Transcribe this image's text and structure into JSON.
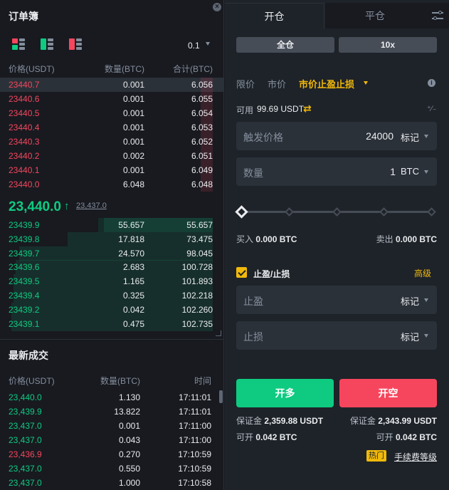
{
  "colors": {
    "buy": "#0ecb81",
    "sell": "#f6465d",
    "accent": "#f0b90b",
    "panel": "#1e2329",
    "bg": "#181a20"
  },
  "orderbook": {
    "title": "订单簿",
    "precision": "0.1",
    "columns": {
      "price": "价格(USDT)",
      "qty": "数量(BTC)",
      "total": "合计(BTC)"
    },
    "asks": [
      {
        "price": "23440.7",
        "qty": "0.001",
        "total": "6.056",
        "depth": 0.06
      },
      {
        "price": "23440.6",
        "qty": "0.001",
        "total": "6.055",
        "depth": 0.06
      },
      {
        "price": "23440.5",
        "qty": "0.001",
        "total": "6.054",
        "depth": 0.06
      },
      {
        "price": "23440.4",
        "qty": "0.001",
        "total": "6.053",
        "depth": 0.06
      },
      {
        "price": "23440.3",
        "qty": "0.001",
        "total": "6.052",
        "depth": 0.06
      },
      {
        "price": "23440.2",
        "qty": "0.002",
        "total": "6.051",
        "depth": 0.06
      },
      {
        "price": "23440.1",
        "qty": "0.001",
        "total": "6.049",
        "depth": 0.06
      },
      {
        "price": "23440.0",
        "qty": "6.048",
        "total": "6.048",
        "depth": 0.06
      }
    ],
    "last_price": "23,440.0",
    "last_arrow": "↑",
    "mark_price": "23,437.0",
    "bids": [
      {
        "price": "23439.9",
        "qty": "55.657",
        "total": "55.657",
        "depth": 0.54,
        "depth2": 0.57
      },
      {
        "price": "23439.8",
        "qty": "17.818",
        "total": "73.475",
        "depth": 0.72,
        "depth2": 0.0
      },
      {
        "price": "23439.7",
        "qty": "24.570",
        "total": "98.045",
        "depth": 0.96,
        "depth2": 0.0
      },
      {
        "price": "23439.6",
        "qty": "2.683",
        "total": "100.728",
        "depth": 0.98,
        "depth2": 0.0
      },
      {
        "price": "23439.5",
        "qty": "1.165",
        "total": "101.893",
        "depth": 0.99,
        "depth2": 0.0
      },
      {
        "price": "23439.4",
        "qty": "0.325",
        "total": "102.218",
        "depth": 0.99,
        "depth2": 0.0
      },
      {
        "price": "23439.2",
        "qty": "0.042",
        "total": "102.260",
        "depth": 1.0,
        "depth2": 0.0
      },
      {
        "price": "23439.1",
        "qty": "0.475",
        "total": "102.735",
        "depth": 1.0,
        "depth2": 0.0
      }
    ]
  },
  "trades": {
    "title": "最新成交",
    "columns": {
      "price": "价格(USDT)",
      "qty": "数量(BTC)",
      "time": "时间"
    },
    "rows": [
      {
        "price": "23,440.0",
        "qty": "1.130",
        "time": "17:11:01",
        "side": "buy"
      },
      {
        "price": "23,439.9",
        "qty": "13.822",
        "time": "17:11:01",
        "side": "buy"
      },
      {
        "price": "23,437.0",
        "qty": "0.001",
        "time": "17:11:00",
        "side": "buy"
      },
      {
        "price": "23,437.0",
        "qty": "0.043",
        "time": "17:11:00",
        "side": "buy"
      },
      {
        "price": "23,436.9",
        "qty": "0.270",
        "time": "17:10:59",
        "side": "sell"
      },
      {
        "price": "23,437.0",
        "qty": "0.550",
        "time": "17:10:59",
        "side": "buy"
      },
      {
        "price": "23,437.0",
        "qty": "1.000",
        "time": "17:10:58",
        "side": "buy"
      }
    ]
  },
  "order_form": {
    "tabs": {
      "open": "开仓",
      "close": "平仓"
    },
    "margin_mode": "全仓",
    "leverage": "10x",
    "order_types": {
      "limit": "限价",
      "market": "市价",
      "stop_market": "市价止盈止损"
    },
    "available_label": "可用",
    "available_value": "99.69 USDT",
    "trigger": {
      "label": "触发价格",
      "value": "24000",
      "unit": "标记"
    },
    "amount": {
      "label": "数量",
      "value": "1",
      "unit": "BTC"
    },
    "slider_level": 0,
    "buy_label": "买入",
    "buy_value": "0.000 BTC",
    "sell_label": "卖出",
    "sell_value": "0.000 BTC",
    "tpsl_label": "止盈/止损",
    "advanced": "高级",
    "take_profit": {
      "label": "止盈",
      "unit": "标记"
    },
    "stop_loss": {
      "label": "止损",
      "unit": "标记"
    },
    "btn_long": "开多",
    "btn_short": "开空",
    "margin_label": "保证金",
    "long_margin": "2,359.88 USDT",
    "short_margin": "2,343.99 USDT",
    "openable_label": "可开",
    "long_openable": "0.042 BTC",
    "short_openable": "0.042 BTC",
    "hot_badge": "热门",
    "fee_link": "手续费等级"
  }
}
